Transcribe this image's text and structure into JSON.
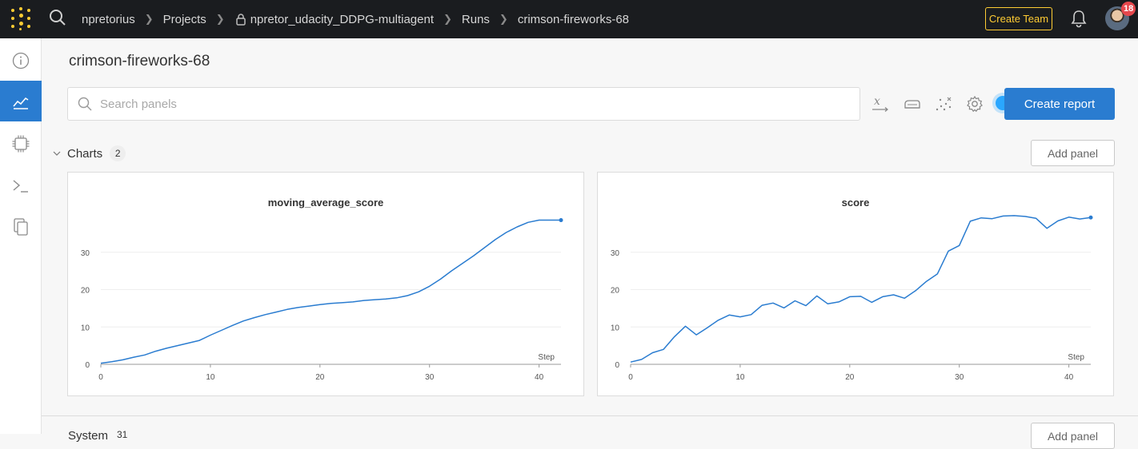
{
  "nav": {
    "breadcrumbs": [
      "npretorius",
      "Projects",
      "npretor_udacity_DDPG-multiagent",
      "Runs",
      "crimson-fireworks-68"
    ],
    "create_team_label": "Create Team",
    "notification_count": "18",
    "brand_color": "#ffcc33"
  },
  "sidebar": {
    "items": [
      {
        "icon": "info-icon",
        "active": false
      },
      {
        "icon": "charts-icon",
        "active": true
      },
      {
        "icon": "system-chip-icon",
        "active": false
      },
      {
        "icon": "terminal-icon",
        "active": false
      },
      {
        "icon": "files-icon",
        "active": false
      }
    ],
    "active_color": "#2a7cd0"
  },
  "main": {
    "run_title": "crimson-fireworks-68",
    "search": {
      "placeholder": "Search panels",
      "value": ""
    },
    "toolbar_icons": [
      "x-axis-icon",
      "smoothing-icon",
      "outliers-icon",
      "settings-icon"
    ],
    "create_report_label": "Create report",
    "sections": [
      {
        "title": "Charts",
        "count": "2",
        "add_panel_label": "Add panel"
      },
      {
        "title": "System",
        "count": "31",
        "add_panel_label": "Add panel"
      }
    ]
  },
  "chart_data": [
    {
      "type": "line",
      "title": "moving_average_score",
      "xlabel": "Step",
      "ylabel": "",
      "xlim": [
        0,
        42
      ],
      "ylim": [
        0,
        40
      ],
      "xticks": [
        0,
        10,
        20,
        30,
        40
      ],
      "yticks": [
        0,
        10,
        20,
        30
      ],
      "grid": true,
      "color": "#2a7cd0",
      "x": [
        0,
        1,
        2,
        3,
        4,
        5,
        6,
        7,
        8,
        9,
        10,
        11,
        12,
        13,
        14,
        15,
        16,
        17,
        18,
        19,
        20,
        21,
        22,
        23,
        24,
        25,
        26,
        27,
        28,
        29,
        30,
        31,
        32,
        33,
        34,
        35,
        36,
        37,
        38,
        39,
        40,
        41,
        42
      ],
      "y": [
        0.3,
        0.7,
        1.2,
        1.9,
        2.5,
        3.5,
        4.3,
        5.0,
        5.7,
        6.4,
        7.8,
        9.1,
        10.4,
        11.6,
        12.5,
        13.3,
        14.0,
        14.7,
        15.2,
        15.6,
        16.0,
        16.3,
        16.5,
        16.7,
        17.1,
        17.3,
        17.5,
        17.8,
        18.4,
        19.4,
        20.9,
        22.8,
        25.0,
        27.0,
        29.0,
        31.2,
        33.4,
        35.3,
        36.8,
        38.0,
        38.6,
        38.6,
        38.6
      ]
    },
    {
      "type": "line",
      "title": "score",
      "xlabel": "Step",
      "ylabel": "",
      "xlim": [
        0,
        42
      ],
      "ylim": [
        0,
        40
      ],
      "xticks": [
        0,
        10,
        20,
        30,
        40
      ],
      "yticks": [
        0,
        10,
        20,
        30
      ],
      "grid": true,
      "color": "#2a7cd0",
      "x": [
        0,
        1,
        2,
        3,
        4,
        5,
        6,
        7,
        8,
        9,
        10,
        11,
        12,
        13,
        14,
        15,
        16,
        17,
        18,
        19,
        20,
        21,
        22,
        23,
        24,
        25,
        26,
        27,
        28,
        29,
        30,
        31,
        32,
        33,
        34,
        35,
        36,
        37,
        38,
        39,
        40,
        41,
        42
      ],
      "y": [
        0.6,
        1.3,
        3.1,
        4.0,
        7.4,
        10.2,
        7.9,
        9.8,
        11.8,
        13.2,
        12.7,
        13.3,
        15.8,
        16.4,
        15.1,
        17.0,
        15.7,
        18.3,
        16.2,
        16.7,
        18.1,
        18.2,
        16.6,
        18.1,
        18.6,
        17.7,
        19.7,
        22.2,
        24.2,
        30.3,
        31.8,
        38.3,
        39.2,
        39.0,
        39.7,
        39.8,
        39.6,
        39.1,
        36.4,
        38.4,
        39.4,
        38.9,
        39.3
      ]
    }
  ]
}
